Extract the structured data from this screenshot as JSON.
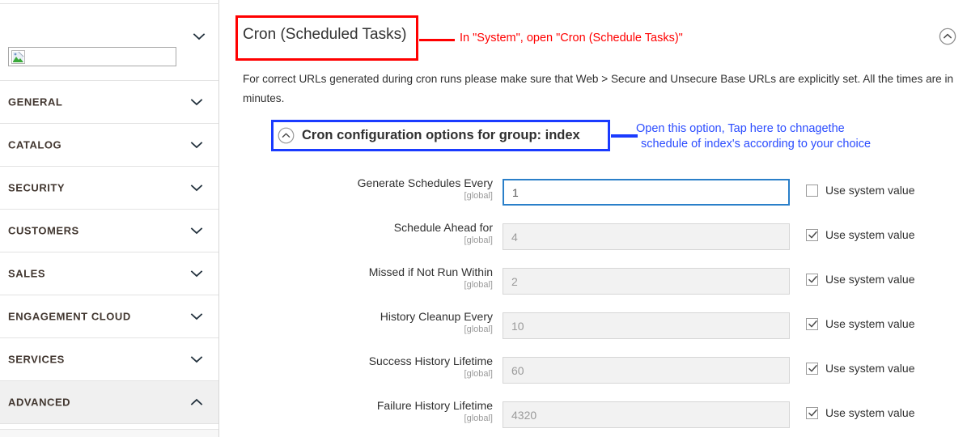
{
  "sidebar": {
    "logo": {
      "icon": "broken-image-icon",
      "chevron": "chevron-down-icon"
    },
    "items": [
      {
        "label": "GENERAL",
        "chevron": "chevron-down-icon",
        "active": false
      },
      {
        "label": "CATALOG",
        "chevron": "chevron-down-icon",
        "active": false
      },
      {
        "label": "SECURITY",
        "chevron": "chevron-down-icon",
        "active": false
      },
      {
        "label": "CUSTOMERS",
        "chevron": "chevron-down-icon",
        "active": false
      },
      {
        "label": "SALES",
        "chevron": "chevron-down-icon",
        "active": false
      },
      {
        "label": "ENGAGEMENT CLOUD",
        "chevron": "chevron-down-icon",
        "active": false
      },
      {
        "label": "SERVICES",
        "chevron": "chevron-down-icon",
        "active": false
      },
      {
        "label": "ADVANCED",
        "chevron": "chevron-up-icon",
        "active": true
      }
    ]
  },
  "main": {
    "page_title": "Cron (Scheduled Tasks)",
    "collapse_all_icon": "circle-chevron-up-icon",
    "intro_text": "For correct URLs generated during cron runs please make sure that Web > Secure and Unsecure Base URLs are explicitly set. All the times are in minutes.",
    "group": {
      "icon": "circle-chevron-up-icon",
      "title": "Cron configuration options for group: index"
    },
    "fields": [
      {
        "label": "Generate Schedules Every",
        "scope": "[global]",
        "value": "1",
        "active": true,
        "use_system_value": false,
        "checkbox_label": "Use system value"
      },
      {
        "label": "Schedule Ahead for",
        "scope": "[global]",
        "value": "4",
        "active": false,
        "use_system_value": true,
        "checkbox_label": "Use system value"
      },
      {
        "label": "Missed if Not Run Within",
        "scope": "[global]",
        "value": "2",
        "active": false,
        "use_system_value": true,
        "checkbox_label": "Use system value"
      },
      {
        "label": "History Cleanup Every",
        "scope": "[global]",
        "value": "10",
        "active": false,
        "use_system_value": true,
        "checkbox_label": "Use system value"
      },
      {
        "label": "Success History Lifetime",
        "scope": "[global]",
        "value": "60",
        "active": false,
        "use_system_value": true,
        "checkbox_label": "Use system value"
      },
      {
        "label": "Failure History Lifetime",
        "scope": "[global]",
        "value": "4320",
        "active": false,
        "use_system_value": true,
        "checkbox_label": "Use system value"
      }
    ]
  },
  "annotations": {
    "red": {
      "text": "In \"System\", open \"Cron (Schedule Tasks)\"",
      "color": "#ff0000"
    },
    "blue": {
      "line1": "Open this option, Tap here to chnagethe",
      "line2": "schedule of index's according to your choice",
      "color": "#2b4cff"
    }
  }
}
